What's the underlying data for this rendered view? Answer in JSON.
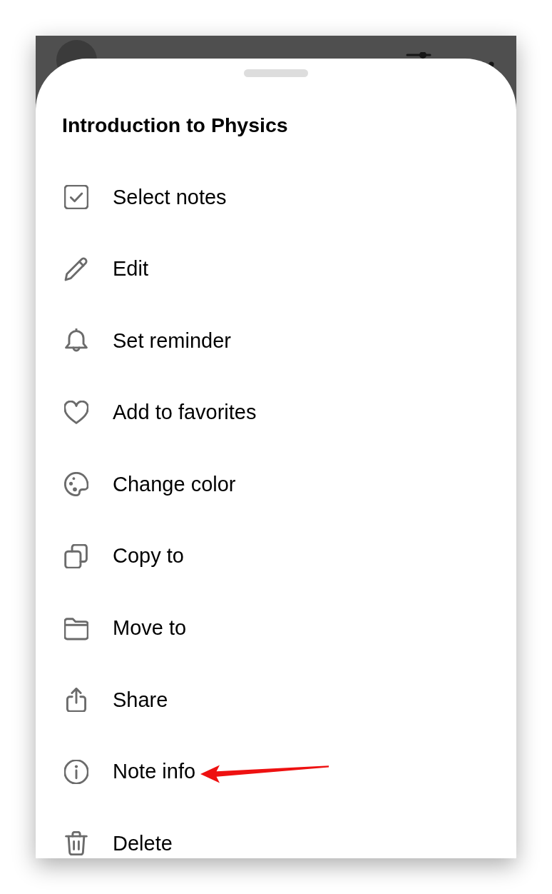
{
  "sheet": {
    "title": "Introduction to Physics",
    "items": [
      {
        "label": "Select notes",
        "pointer_arrow": false
      },
      {
        "label": "Edit",
        "pointer_arrow": false
      },
      {
        "label": "Set reminder",
        "pointer_arrow": false
      },
      {
        "label": "Add to favorites",
        "pointer_arrow": false
      },
      {
        "label": "Change color",
        "pointer_arrow": false
      },
      {
        "label": "Copy to",
        "pointer_arrow": false
      },
      {
        "label": "Move to",
        "pointer_arrow": false
      },
      {
        "label": "Share",
        "pointer_arrow": false
      },
      {
        "label": "Note info",
        "pointer_arrow": true
      },
      {
        "label": "Delete",
        "pointer_arrow": false
      }
    ]
  }
}
